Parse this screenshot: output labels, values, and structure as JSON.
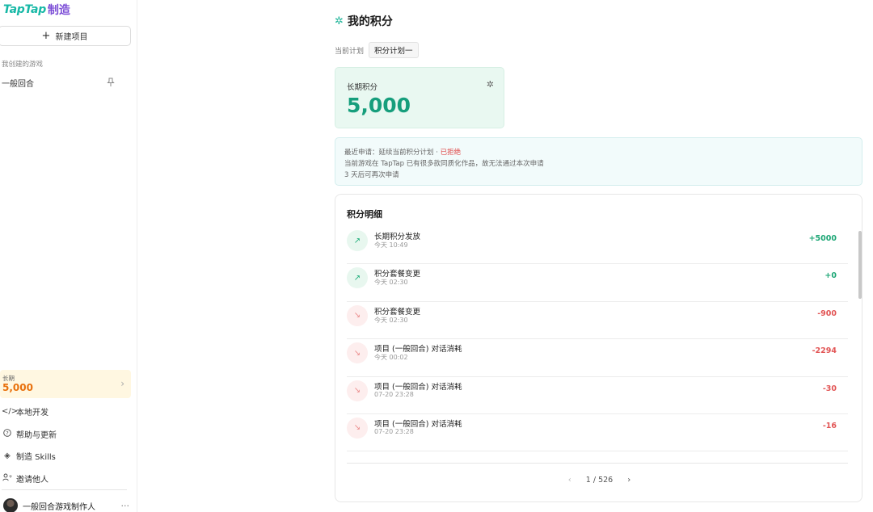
{
  "sidebar": {
    "logo_text": "TapTap",
    "logo_suffix": "制造",
    "new_project_label": "新建项目",
    "section_label": "我创建的游戏",
    "games": [
      {
        "name": "一般回合"
      }
    ],
    "credit": {
      "label": "长期",
      "value": "5,000"
    },
    "nav": [
      {
        "icon": "</>",
        "label": "本地开发"
      },
      {
        "icon": "?",
        "label": "帮助与更新"
      },
      {
        "icon": "◈",
        "label": "制造 Skills"
      },
      {
        "icon": "+",
        "label": "邀请他人"
      }
    ],
    "user": {
      "name": "一般回合游戏制作人",
      "more": "···"
    }
  },
  "main": {
    "title": "我的积分",
    "current_plan_label": "当前计划",
    "current_plan": "积分计划一",
    "long_term": {
      "label": "长期积分",
      "value": "5,000"
    },
    "notice": {
      "line1_prefix": "最近申请：延续当前积分计划 · ",
      "line1_status": "已拒绝",
      "line2": "当前游戏在 TapTap 已有很多款同质化作品，故无法通过本次申请",
      "line3": "3 天后可再次申请"
    },
    "detail_title": "积分明细",
    "records": [
      {
        "name": "长期积分发放",
        "time": "今天 10:49",
        "amount": "+5000",
        "direction": "up"
      },
      {
        "name": "积分套餐变更",
        "time": "今天 02:30",
        "amount": "+0",
        "direction": "up"
      },
      {
        "name": "积分套餐变更",
        "time": "今天 02:30",
        "amount": "-900",
        "direction": "down"
      },
      {
        "name": "项目 (一般回合) 对话消耗",
        "time": "今天 00:02",
        "amount": "-2294",
        "direction": "down"
      },
      {
        "name": "项目 (一般回合) 对话消耗",
        "time": "07-20 23:28",
        "amount": "-30",
        "direction": "down"
      },
      {
        "name": "项目 (一般回合) 对话消耗",
        "time": "07-20 23:28",
        "amount": "-16",
        "direction": "down"
      }
    ],
    "pagination": {
      "text": "1 / 526"
    }
  },
  "colors": {
    "accent_green": "#169e7c",
    "negative_red": "#e25555",
    "credit_orange": "#e8700c"
  }
}
